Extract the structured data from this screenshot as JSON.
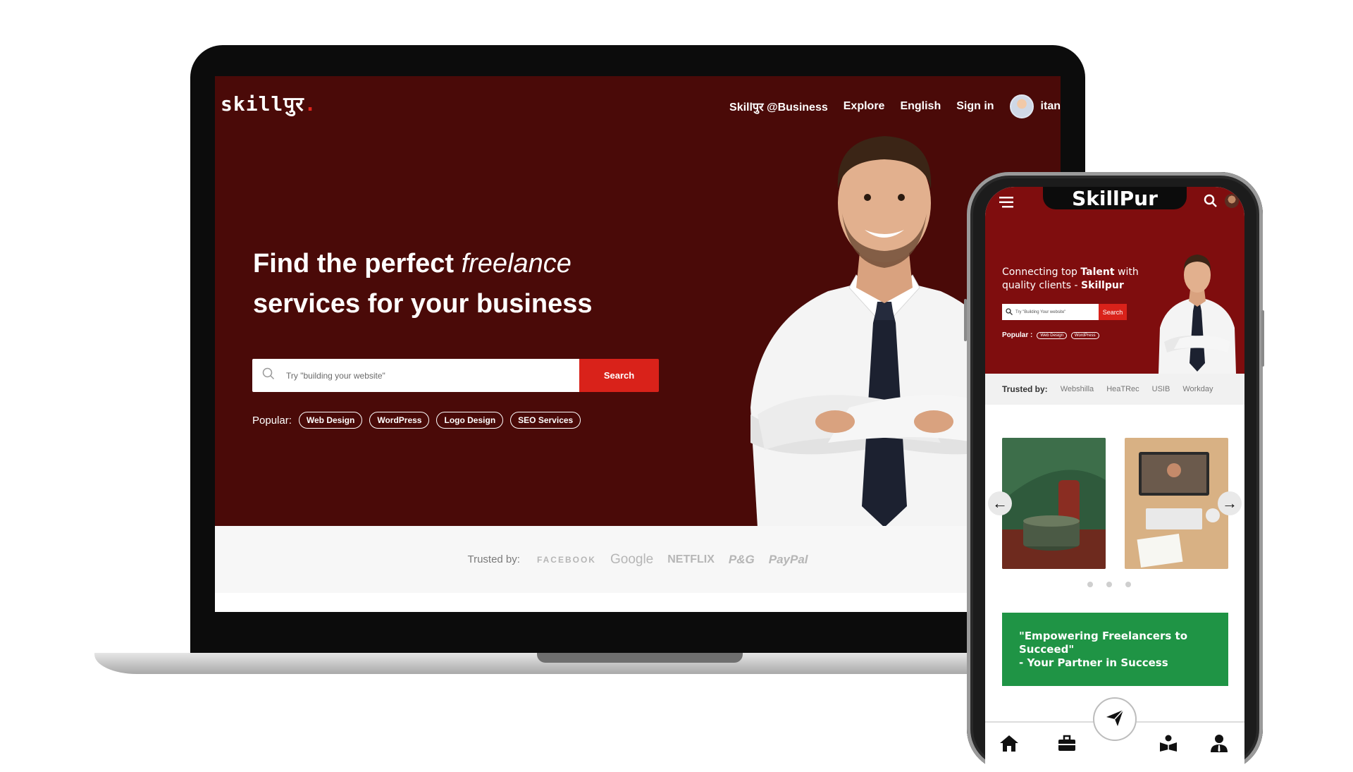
{
  "laptop": {
    "logo": "skillपुर",
    "logo_dot": ".",
    "nav": {
      "business": "Skillपुर @Business",
      "explore": "Explore",
      "language": "English",
      "signin": "Sign in",
      "username": "itan"
    },
    "hero": {
      "headline_part1": "Find the perfect ",
      "headline_italic": "freelance",
      "headline_line2": "services for your business"
    },
    "search": {
      "placeholder": "Try \"building your website\"",
      "button": "Search"
    },
    "popular": {
      "label": "Popular:",
      "tags": [
        "Web Design",
        "WordPress",
        "Logo Design",
        "SEO Services"
      ]
    },
    "trusted": {
      "label": "Trusted by:",
      "brands": [
        "FACEBOOK",
        "Google",
        "NETFLIX",
        "P&G",
        "PayPal"
      ]
    }
  },
  "phone": {
    "title": "SkillPur",
    "hero": {
      "line1_pre": "Connecting top ",
      "line1_bold": "Talent",
      "line1_post": " with",
      "line2_pre": "quality clients - ",
      "line2_bold": "Skillpur"
    },
    "search": {
      "placeholder": "Try \"Building Your website\"",
      "button": "Search"
    },
    "popular": {
      "label": "Popular :",
      "tags": [
        "Web Design",
        "WordPress"
      ]
    },
    "trusted": {
      "label": "Trusted by:",
      "brands": [
        "Webshilla",
        "HeaTRec",
        "USIB",
        "Workday"
      ]
    },
    "banner": {
      "line1": "\"Empowering Freelancers to Succeed\"",
      "line2": "- Your Partner in Success"
    },
    "nav_icons": [
      "home-icon",
      "briefcase-icon",
      "send-icon",
      "reader-icon",
      "user-icon"
    ]
  },
  "colors": {
    "laptop_hero_bg": "#4a0a08",
    "phone_header_bg": "#7f0d0e",
    "accent_red": "#d9221a",
    "banner_green": "#1f9445"
  }
}
